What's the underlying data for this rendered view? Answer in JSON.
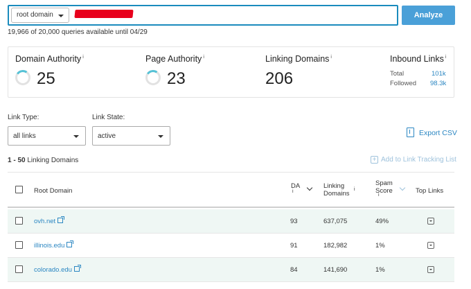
{
  "search": {
    "scope_value": "root domain",
    "analyze_label": "Analyze",
    "quota_text": "19,966 of 20,000 queries available until 04/29"
  },
  "metrics": {
    "domain_authority": {
      "label": "Domain Authority",
      "sup": "i",
      "value": "25"
    },
    "page_authority": {
      "label": "Page Authority",
      "sup": "i",
      "value": "23"
    },
    "linking_domains": {
      "label": "Linking Domains",
      "sup": "i",
      "value": "206"
    },
    "inbound_links": {
      "label": "Inbound Links",
      "sup": "i",
      "total_label": "Total",
      "total_value": "101k",
      "followed_label": "Followed",
      "followed_value": "98.3k"
    }
  },
  "filters": {
    "link_type_label": "Link Type:",
    "link_type_value": "all links",
    "link_state_label": "Link State:",
    "link_state_value": "active"
  },
  "actions": {
    "export_label": "Export CSV",
    "add_tracking_label": "Add to Link Tracking List",
    "add_tracking_plus": "+"
  },
  "range": {
    "count": "1 - 50",
    "label": "Linking Domains"
  },
  "table": {
    "headers": {
      "root_domain": "Root Domain",
      "da": "DA",
      "da_info": "i",
      "linking_1": "Linking",
      "linking_2": "Domains",
      "linking_info": "i",
      "spam_1": "Spam",
      "spam_2": "Score",
      "spam_info": "i",
      "top_links": "Top Links"
    },
    "rows": [
      {
        "domain": "ovh.net",
        "da": "93",
        "linking": "637,075",
        "spam": "49%"
      },
      {
        "domain": "illinois.edu",
        "da": "91",
        "linking": "182,982",
        "spam": "1%"
      },
      {
        "domain": "colorado.edu",
        "da": "84",
        "linking": "141,690",
        "spam": "1%"
      }
    ]
  },
  "colors": {
    "accent": "#1a8bbd",
    "button": "#4aa0d8",
    "link": "#2a86c2",
    "ring": "#56c2d6",
    "row_shade": "#eff7f4"
  }
}
